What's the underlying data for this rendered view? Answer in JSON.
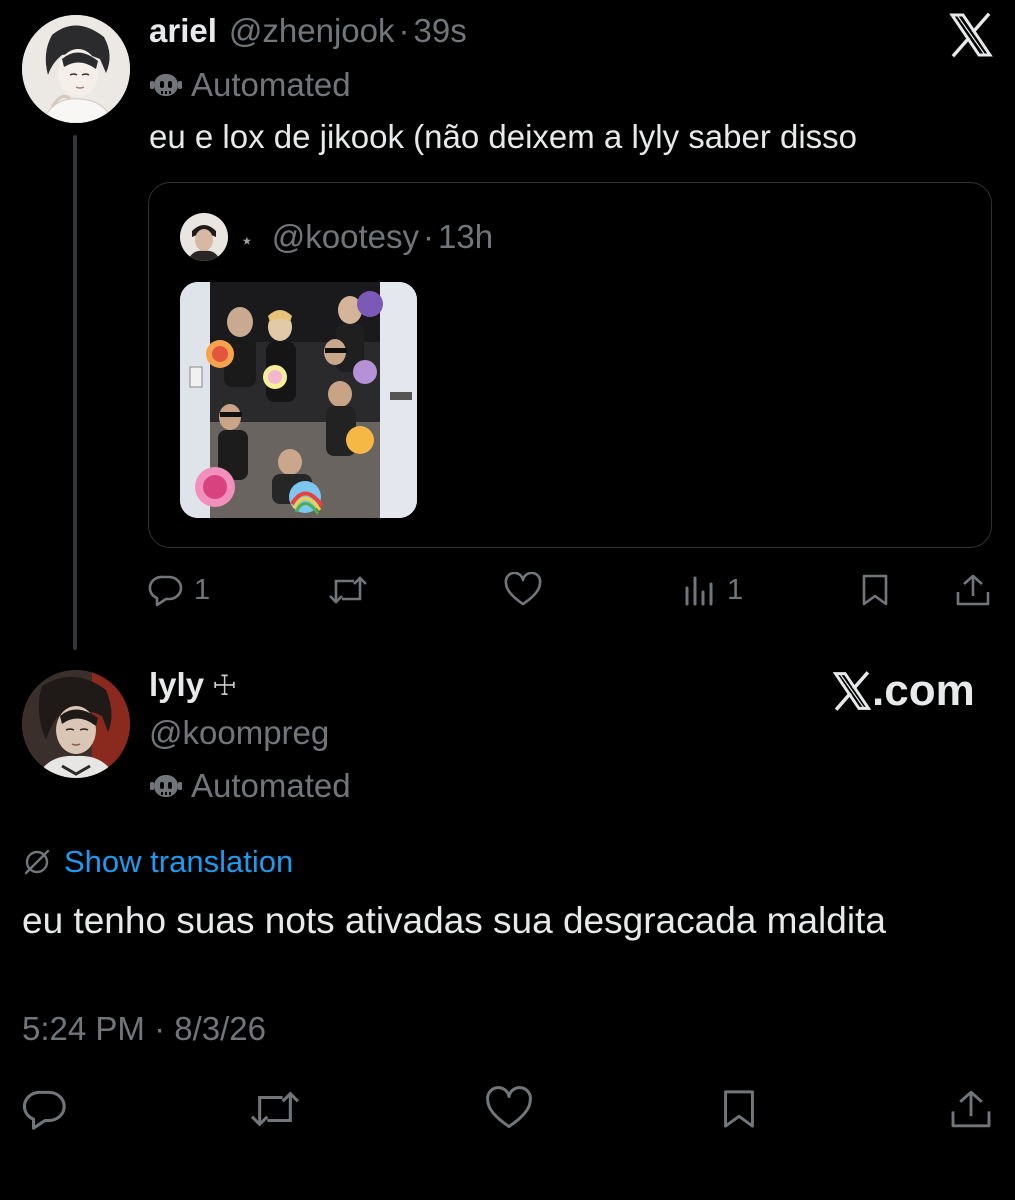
{
  "tweet1": {
    "display_name": "ariel",
    "handle": "@zhenjook",
    "separator": "·",
    "time": "39s",
    "automated_label": "Automated",
    "text": "eu e lox de jikook (não deixem a lyly saber disso",
    "quote": {
      "sparkle": "⋆",
      "handle": "@kootesy",
      "separator": "·",
      "time": "13h"
    },
    "actions": {
      "reply_count": "1",
      "views_count": "1"
    }
  },
  "tweet2": {
    "display_name": "lyly",
    "name_symbol": "☩",
    "handle": "@koompreg",
    "automated_label": "Automated",
    "show_translation": "Show translation",
    "text": "eu tenho suas nots ativadas sua desgracada maldita",
    "timestamp": "5:24 PM · 8/3/26"
  },
  "branding": {
    "x_com": ".com"
  },
  "colors": {
    "background": "#000000",
    "text_primary": "#e7e9ea",
    "text_muted": "#71767b",
    "link": "#1d9bf0",
    "border": "#2f3336"
  },
  "icons": {
    "close": "x-logo-icon",
    "bot": "bot-icon",
    "reply": "reply-icon",
    "retweet": "retweet-icon",
    "like": "heart-icon",
    "views": "views-icon",
    "bookmark": "bookmark-icon",
    "share": "share-icon",
    "translate": "translate-icon"
  }
}
